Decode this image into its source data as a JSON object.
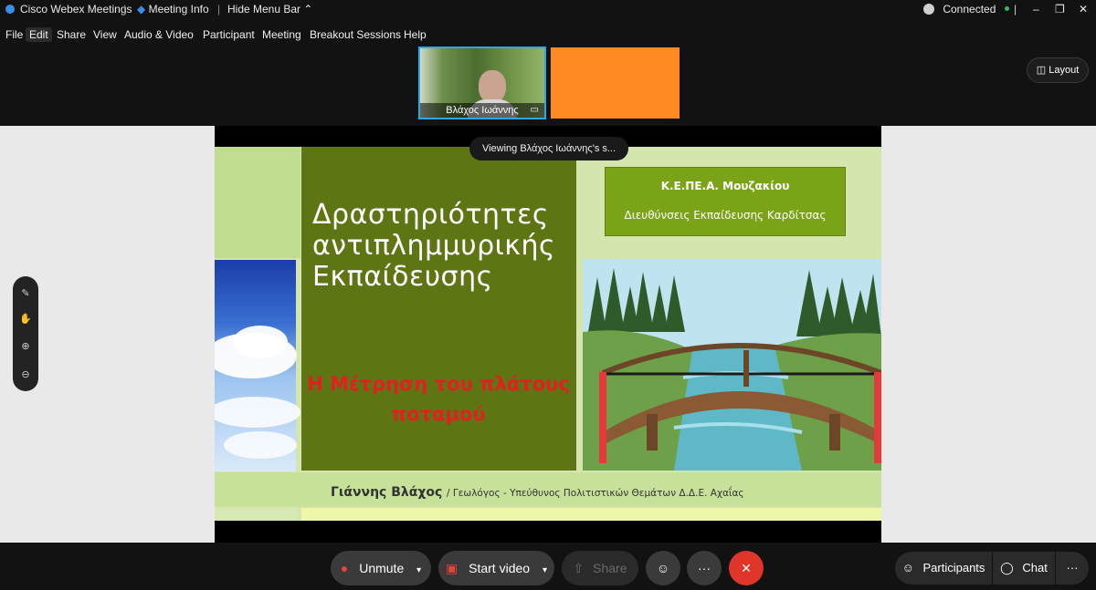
{
  "titlebar": {
    "app_name": "Cisco Webex Meetings",
    "sep1": "|",
    "meeting_info": "Meeting Info",
    "sep2": "|",
    "hide_menu": "Hide Menu Bar",
    "connected": "Connected",
    "sep3": "|"
  },
  "menu": [
    "File",
    "Edit",
    "Share",
    "View",
    "Audio & Video",
    "Participant",
    "Meeting",
    "Breakout Sessions",
    "Help"
  ],
  "thumbnail": {
    "name": "Βλάχος Ιωάννης"
  },
  "layout_label": "Layout",
  "viewing_text": "Viewing Βλάχος Ιωάννης's s...",
  "slide": {
    "title_lines": [
      "Δραστηριότητες",
      "αντιπλημμυρικής",
      "Εκπαίδευσης"
    ],
    "subtitle_lines": [
      "Η Μέτρηση του πλάτους",
      "ποταμού"
    ],
    "org_line1": "Κ.Ε.ΠΕ.Α. Μουζακίου",
    "org_line2": "Διευθύνσεις Εκπαίδευσης Καρδίτσας",
    "author_name": "Γιάννης Βλάχος",
    "author_role": "/ Γεωλόγος - Υπεύθυνος Πολιτιστικών Θεμάτων Δ.Δ.Ε. Αχαΐας"
  },
  "controls": {
    "unmute": "Unmute",
    "start_video": "Start video",
    "share": "Share",
    "more": "···",
    "participants": "Participants",
    "chat": "Chat",
    "overflow": "···"
  },
  "colors": {
    "accent_blue": "#2da7e6",
    "end_red": "#e0352b",
    "connected_green": "#2dbd5a",
    "slide_olive": "#5d7513"
  }
}
